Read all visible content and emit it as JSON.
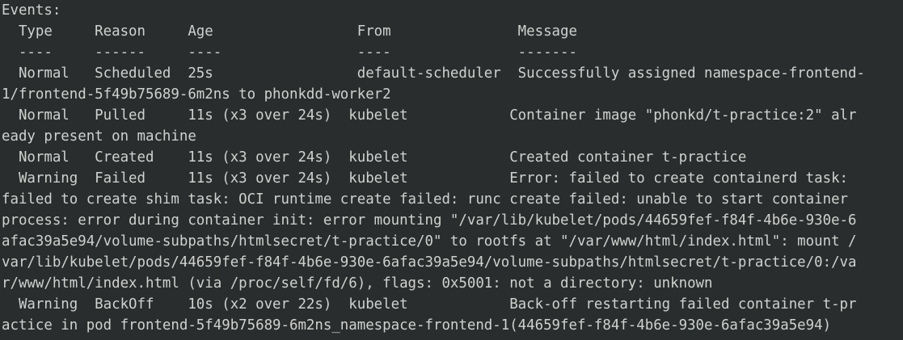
{
  "terminal": {
    "colors": {
      "background": "#2a2d2e",
      "foreground": "#cfd2cd"
    },
    "lines": [
      "Events:",
      "  Type     Reason     Age                 From               Message",
      "  ----     ------     ----                ----               -------",
      "  Normal   Scheduled  25s                 default-scheduler  Successfully assigned namespace-frontend-",
      "1/frontend-5f49b75689-6m2ns to phonkdd-worker2",
      "  Normal   Pulled     11s (x3 over 24s)  kubelet            Container image \"phonkd/t-practice:2\" alr",
      "eady present on machine",
      "  Normal   Created    11s (x3 over 24s)  kubelet            Created container t-practice",
      "  Warning  Failed     11s (x3 over 24s)  kubelet            Error: failed to create containerd task:",
      "failed to create shim task: OCI runtime create failed: runc create failed: unable to start container",
      "process: error during container init: error mounting \"/var/lib/kubelet/pods/44659fef-f84f-4b6e-930e-6",
      "afac39a5e94/volume-subpaths/htmlsecret/t-practice/0\" to rootfs at \"/var/www/html/index.html\": mount /",
      "var/lib/kubelet/pods/44659fef-f84f-4b6e-930e-6afac39a5e94/volume-subpaths/htmlsecret/t-practice/0:/va",
      "r/www/html/index.html (via /proc/self/fd/6), flags: 0x5001: not a directory: unknown",
      "  Warning  BackOff    10s (x2 over 22s)  kubelet            Back-off restarting failed container t-pr",
      "actice in pod frontend-5f49b75689-6m2ns_namespace-frontend-1(44659fef-f84f-4b6e-930e-6afac39a5e94)"
    ]
  }
}
